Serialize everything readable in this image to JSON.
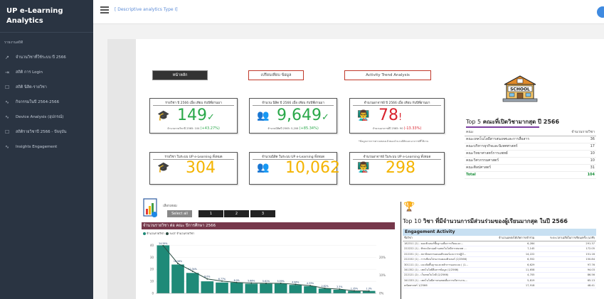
{
  "app": {
    "title": "UP e-Learning Analytics"
  },
  "sidebar": {
    "section": "รายงานสถิติ",
    "items": [
      {
        "label": "จำนวนวิชาที่ใช้ระบบ ปี 2566",
        "icon": "trend-up-icon",
        "glyph": "↗"
      },
      {
        "label": "สถิติ การ Login",
        "icon": "login-icon",
        "glyph": "⇥"
      },
      {
        "label": "สถิติ นิสิต-รายวิชา",
        "icon": "square-icon",
        "glyph": "☐"
      },
      {
        "label": "กิจกรรมในปี 2564-2566",
        "icon": "activity-icon",
        "glyph": "∿"
      },
      {
        "label": "Device Analysis (อุปกรณ์)",
        "icon": "activity-icon",
        "glyph": "∿"
      },
      {
        "label": "สถิติรายวิชาปี 2566 - ปัจจุบัน",
        "icon": "square-icon",
        "glyph": "☐"
      },
      {
        "label": "Insights Engagement",
        "icon": "activity-icon",
        "glyph": "∿"
      }
    ]
  },
  "topbar": {
    "breadcrumb": "[ Descriptive analytics Type I]"
  },
  "tabs": [
    {
      "label": "หน้าหลัก"
    },
    {
      "label": "เปรียบเทียบ ข้อมูล"
    },
    {
      "label": "Activity Trend Analysis"
    }
  ],
  "kpis": [
    {
      "title": "รายวิชา ปี 2566 เมื่อ เทียบ กับปีที่ผ่านมา",
      "value": "149",
      "mark": "✓",
      "sub_prefix": "จำนวนรายวิชาปี 2565: 104 ",
      "sub_change": "(+43.27%)",
      "icon": "graduation-cap-icon",
      "glyph": "🎓",
      "color": "#2aa84a"
    },
    {
      "title": "จำนวน นิสิต ปี 2566 เมื่อ เทียบ กับปีที่ผ่านมา",
      "value": "9,649",
      "mark": "✓",
      "sub_prefix": "จำนวนนิสิตปี 2565: 5,206 ",
      "sub_change": "(+85.34%)",
      "icon": "students-icon",
      "glyph": "👥",
      "color": "#2aa84a"
    },
    {
      "title": "จำนวนอาจารย์ ปี 2566 เมื่อ เทียบ กับปีที่ผ่านมา",
      "value": "78",
      "mark": "!",
      "sub_prefix": "จำนวนอาจารย์ปี 2565: 90 ",
      "sub_change": "(-13.33%)",
      "icon": "teacher-icon",
      "glyph": "👨‍🏫",
      "color": "#d9232e"
    },
    {
      "title": "รายวิชา ในระบบ UP e-Learning ทั้งหมด",
      "value": "304",
      "icon": "graduation-cap-icon",
      "glyph": "🎓",
      "color": "#f4b400"
    },
    {
      "title": "จำนวนนิสิต ในระบบ UP e-Learning ทั้งหมด",
      "value": "10,062",
      "icon": "students-icon",
      "glyph": "👥",
      "color": "#f4b400"
    },
    {
      "title": "จำนวนอาจารย์ ในระบบ UP e-Learning ทั้งหมด",
      "value": "298",
      "icon": "teacher-icon",
      "glyph": "👨‍🏫",
      "color": "#f4b400"
    }
  ],
  "note": "*ข้อมูลจากการตรวจสอบแล้วของจำนวนนิสิตและอาจารย์ที่ใช้งาน",
  "school_label": "SCHOOL",
  "top5": {
    "title_prefix": "Top 5 ",
    "title_main": "คณะที่เปิดวิชามากสุด ปี 2566",
    "head": [
      "คณะ",
      "จำนวนรายวิชา"
    ],
    "rows": [
      [
        "คณะเทคโนโลยีสารสนเทศและการสื่อสาร",
        "36"
      ],
      [
        "คณะบริหารธุรกิจและนิเทศศาสตร์",
        "17"
      ],
      [
        "คณะวิทยาศาสตร์การแพทย์",
        "10"
      ],
      [
        "คณะวิศวกรรมศาสตร์",
        "10"
      ],
      [
        "คณะศิลปศาสตร์",
        "31"
      ]
    ],
    "total": [
      "Total",
      "104"
    ]
  },
  "filter": {
    "label": "เลือกเทอม",
    "buttons": [
      "Select all",
      "1",
      "2",
      "3"
    ]
  },
  "bar_chart_title": "จำนวนรายวิชา ต่อ คณะ ปีการศึกษา 2566",
  "colors": {
    "accent": "#1f8a78",
    "dark": "#2b4d42",
    "title_bar": "#76384b",
    "trophy": "#e0a400"
  },
  "chart_data": {
    "type": "bar",
    "series": [
      {
        "name": "จำนวนรายวิชา",
        "values": [
          40,
          24,
          17,
          10,
          9,
          9,
          8,
          8,
          8,
          7,
          6,
          4,
          3,
          2,
          2
        ]
      },
      {
        "name": "%GT จำนวนรายวิชา",
        "values": [
          26.5,
          16.6,
          12.3,
          8.0,
          6.8,
          6.0,
          5.7,
          5.6,
          5.6,
          5.0,
          4.3,
          2.8,
          2.3,
          1.4,
          1.3
        ]
      }
    ],
    "data_labels": [
      "24.59%",
      "16.56%",
      "12.34%",
      "8.0%",
      "6.77%",
      "6.0%",
      "5.66%",
      "5.61%",
      "5.59%",
      "4.96%",
      "4.33%",
      "2.82%",
      "2.3%",
      "1.35%",
      "1.3%"
    ],
    "yticks_left": [
      "0",
      "10",
      "20",
      "30",
      "40"
    ],
    "yticks_right": [
      "0%",
      "10%",
      "20%"
    ],
    "ylim": [
      0,
      45
    ]
  },
  "top10": {
    "title_prefix": "Top 10 ",
    "title_main": "วิชา ที่มีจำนวนการมีส่วนร่วมของผู้เรียนมากสุด ในปี 2566"
  },
  "engagement": {
    "title": "Engagement Activity",
    "head": [
      "ชื่อวิชา",
      "จำนวนแหล่งได้เกิดการเข้าร่วม",
      "ระยะเวลาเฉลี่ยในการเรียน/ครั้ง (นาที)"
    ],
    "rows": [
      [
        "182311 (2) - คอมพิวเตอร์พื้นฐานเพื่อการเรียนและ...",
        "6,284",
        "291.37"
      ],
      [
        "222222 (1) - ทักษะอังกฤษด้านเทคโนโลยีสารสนเทศ ...",
        "7,145",
        "172.05"
      ],
      [
        "222151 (1) - สถาปัตยกรรมคอมพิวเตอร์และการปฏิบั...",
        "14,222",
        "151.16"
      ],
      [
        "222152 (1) - การเขียนโปรแกรมคอมพิวเตอร์ (2/2566)",
        "6,552",
        "150.84"
      ],
      [
        "301111 (1) - แนวคิดพื้นฐานและหลักการออกแบบ ( (1...",
        "6,629",
        "97.76"
      ],
      [
        "341352 (1) - เทคโนโลยีสื่อสารข้อมูล (1/2566)",
        "11,658",
        "94.03"
      ],
      [
        "222121 (2) - เว็บเทคโนโลยี (2/2566)",
        "4,705",
        "86.56"
      ],
      [
        "341333 (1) - เทคโนโลยีสารสนเทศเพื่อการบริหารงาน...",
        "5,819",
        "65.13"
      ],
      [
        "คณิตศาสตร์ 1/2566",
        "17,918",
        "48.41"
      ]
    ]
  }
}
